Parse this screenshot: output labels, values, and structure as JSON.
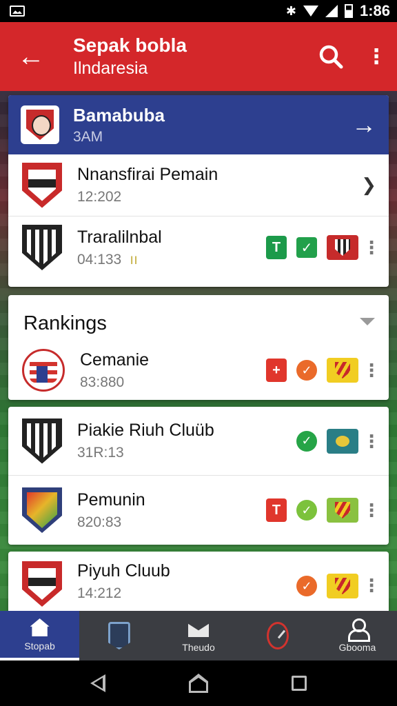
{
  "status_bar": {
    "time": "1:86"
  },
  "app_bar": {
    "title": "Sepak bobla",
    "subtitle": "Ilndaresia"
  },
  "feed_card": {
    "header": {
      "title": "Bamabuba",
      "subtitle": "3AM"
    },
    "rows": [
      {
        "title": "Nnansfirai Pemain",
        "time": "12:202"
      },
      {
        "title": "Traralilnbal",
        "time": "04:133",
        "extra": "ıı",
        "badges": {
          "square": "T"
        }
      }
    ]
  },
  "rankings_card": {
    "title": "Rankings",
    "rows": [
      {
        "title": "Cemanie",
        "time": "83:880",
        "badge_square": "+"
      }
    ]
  },
  "clubs_card": {
    "rows": [
      {
        "title": "Piakie Riuh Cluüb",
        "time": "31R:13"
      },
      {
        "title": "Pemunin",
        "time": "820:83",
        "badge_square": "T"
      },
      {
        "title": "Piyuh Cluub",
        "time": "14:212"
      }
    ]
  },
  "bottom_nav": {
    "items": [
      {
        "label": "Stopab",
        "icon": "home-icon",
        "active": true
      },
      {
        "label": "",
        "icon": "badge-icon"
      },
      {
        "label": "Theudo",
        "icon": "mail-icon"
      },
      {
        "label": "",
        "icon": "clock-icon"
      },
      {
        "label": "Gbooma",
        "icon": "person-icon"
      }
    ]
  },
  "colors": {
    "app_bar": "#d4272a",
    "card_header": "#2d3f8f",
    "bottom_nav": "#3b3d42",
    "active_nav": "#2d3f8f"
  }
}
